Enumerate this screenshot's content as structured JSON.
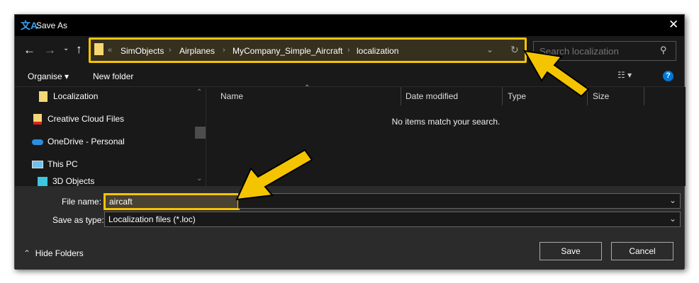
{
  "title": "Save As",
  "breadcrumb": {
    "overflow": "«",
    "items": [
      "SimObjects",
      "Airplanes",
      "MyCompany_Simple_Aircraft",
      "localization"
    ]
  },
  "search": {
    "placeholder": "Search localization"
  },
  "toolbar": {
    "organise": "Organise",
    "new_folder": "New folder"
  },
  "sidebar": {
    "items": [
      {
        "label": "Localization"
      },
      {
        "label": "Creative Cloud Files"
      },
      {
        "label": "OneDrive - Personal"
      },
      {
        "label": "This PC"
      },
      {
        "label": "3D Objects"
      }
    ]
  },
  "columns": [
    "Name",
    "Date modified",
    "Type",
    "Size"
  ],
  "empty_message": "No items match your search.",
  "form": {
    "file_name_label": "File name:",
    "file_name": "aircaft",
    "type_label": "Save as type:",
    "type_value": "Localization files (*.loc)"
  },
  "buttons": {
    "hide_folders": "Hide Folders",
    "save": "Save",
    "cancel": "Cancel"
  },
  "colors": {
    "highlight": "#f5c400",
    "accent": "#0078d7"
  }
}
